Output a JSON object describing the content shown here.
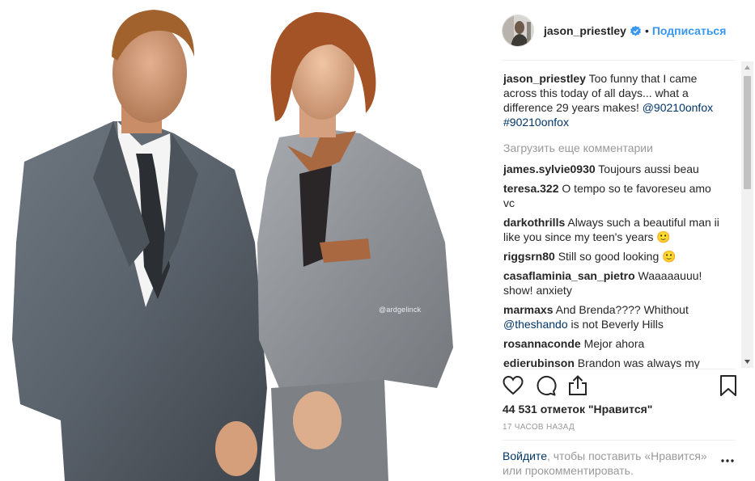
{
  "photo": {
    "watermark": "@ardgelinck",
    "icon": "photo-two-men"
  },
  "header": {
    "username": "jason_priestley",
    "separator": "•",
    "follow_label": "Подписаться",
    "verified_icon": "verified-badge-icon",
    "accent_color": "#3897f0"
  },
  "caption": {
    "username": "jason_priestley",
    "text": " Too funny that I came across this today of all days... what a difference 29 years makes! ",
    "mention": "@90210onfox",
    "hashtag": "#90210onfox"
  },
  "load_more_label": "Загрузить еще комментарии",
  "comments": [
    {
      "username": "james.sylvie0930",
      "text": " Toujours aussi beau"
    },
    {
      "username": "teresa.322",
      "text": " O tempo so te favoreseu amo vc"
    },
    {
      "username": "darkothrills",
      "text": " Always such a beautiful man ii like you since my teen's years 🙂"
    },
    {
      "username": "riggsrn80",
      "text": " Still so good looking 🙂"
    },
    {
      "username": "casaflaminia_san_pietro",
      "text": " Waaaaauuu! show! anxiety"
    },
    {
      "username": "marmaxs",
      "text": " And Brenda???? Whithout ",
      "mention": "@theshando",
      "text_after": " is not Beverly Hills"
    },
    {
      "username": "rosannaconde",
      "text": " Мejor ahora"
    },
    {
      "username": "edierubinson",
      "text": " Brandon was always my favorite!"
    }
  ],
  "actions": {
    "like_icon": "heart-outline-icon",
    "comment_icon": "speech-bubble-icon",
    "share_icon": "share-upload-icon",
    "save_icon": "bookmark-icon"
  },
  "likes_text": "44 531 отметок \"Нравится\"",
  "timestamp": "17 часов назад",
  "login_prompt": {
    "link": "Войдите",
    "text": ", чтобы поставить «Нравится» или прокомментировать."
  },
  "more_icon": "ellipsis-icon"
}
